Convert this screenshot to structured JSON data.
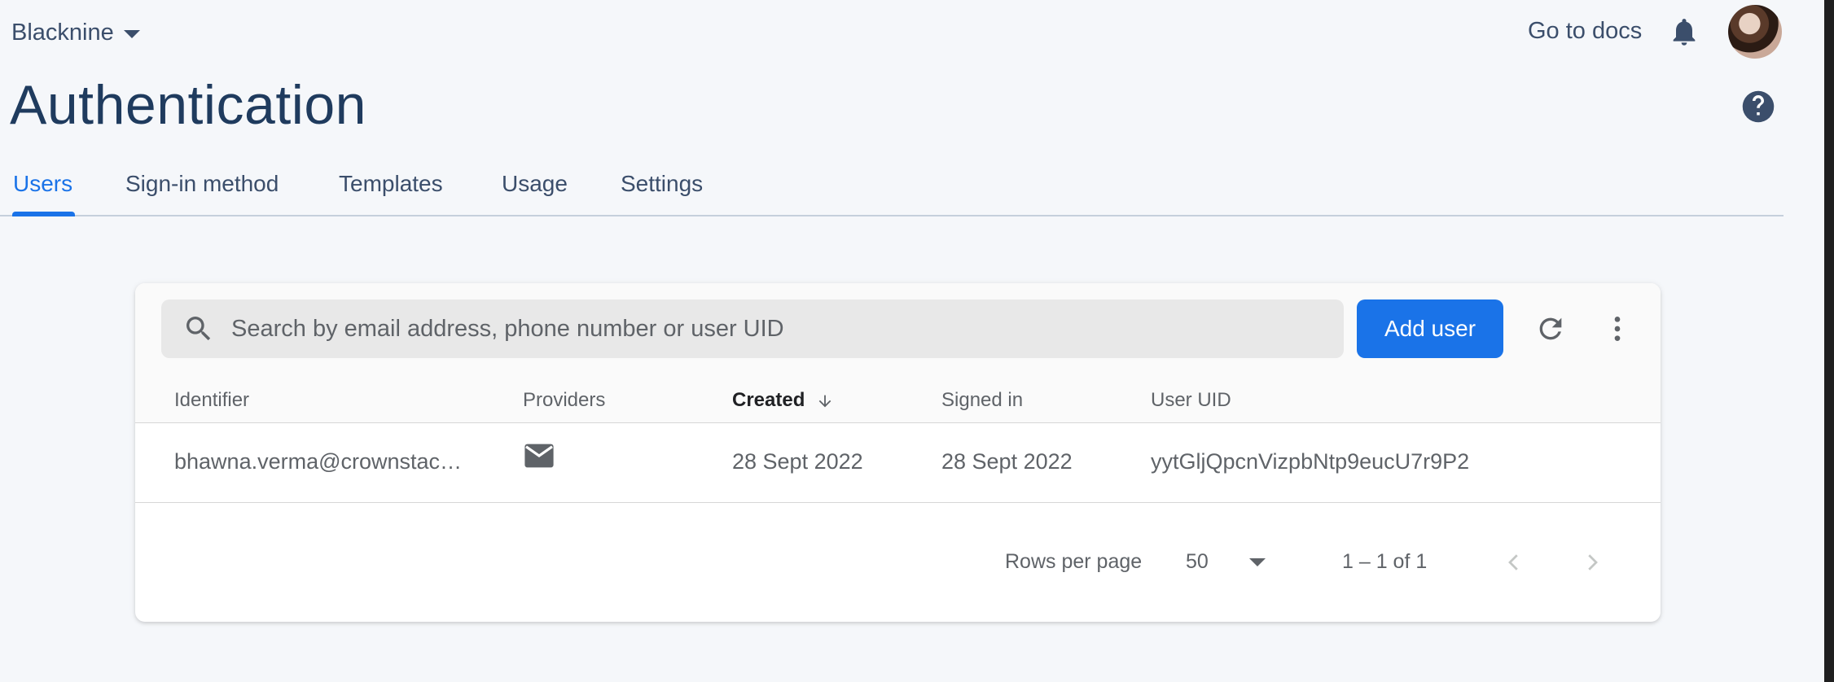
{
  "header": {
    "project_name": "Blacknine",
    "docs_link": "Go to docs",
    "page_title": "Authentication"
  },
  "tabs": [
    {
      "label": "Users",
      "active": true
    },
    {
      "label": "Sign-in method",
      "active": false
    },
    {
      "label": "Templates",
      "active": false
    },
    {
      "label": "Usage",
      "active": false
    },
    {
      "label": "Settings",
      "active": false
    }
  ],
  "toolbar": {
    "search_placeholder": "Search by email address, phone number or user UID",
    "search_value": "",
    "add_user_label": "Add user"
  },
  "table": {
    "columns": [
      "Identifier",
      "Providers",
      "Created",
      "Signed in",
      "User UID"
    ],
    "sorted_column": "Created",
    "sort_direction": "descending",
    "rows": [
      {
        "identifier": "bhawna.verma@crownstac…",
        "provider_icon": "mail-icon",
        "created": "28 Sept 2022",
        "signed_in": "28 Sept 2022",
        "uid": "yytGljQpcnVizpbNtp9eucU7r9P2"
      }
    ]
  },
  "pagination": {
    "rows_per_page_label": "Rows per page",
    "rows_per_page_value": "50",
    "range_text": "1 – 1 of 1"
  },
  "colors": {
    "accent": "#1a73e8",
    "title": "#1f3b5e",
    "nav_text": "#3b4e6b",
    "background": "#f5f7fa"
  },
  "icons": [
    "chevron-down-icon",
    "bell-icon",
    "help-icon",
    "search-icon",
    "refresh-icon",
    "more-vert-icon",
    "arrow-down-icon",
    "mail-icon",
    "chevron-left-icon",
    "chevron-right-icon"
  ]
}
